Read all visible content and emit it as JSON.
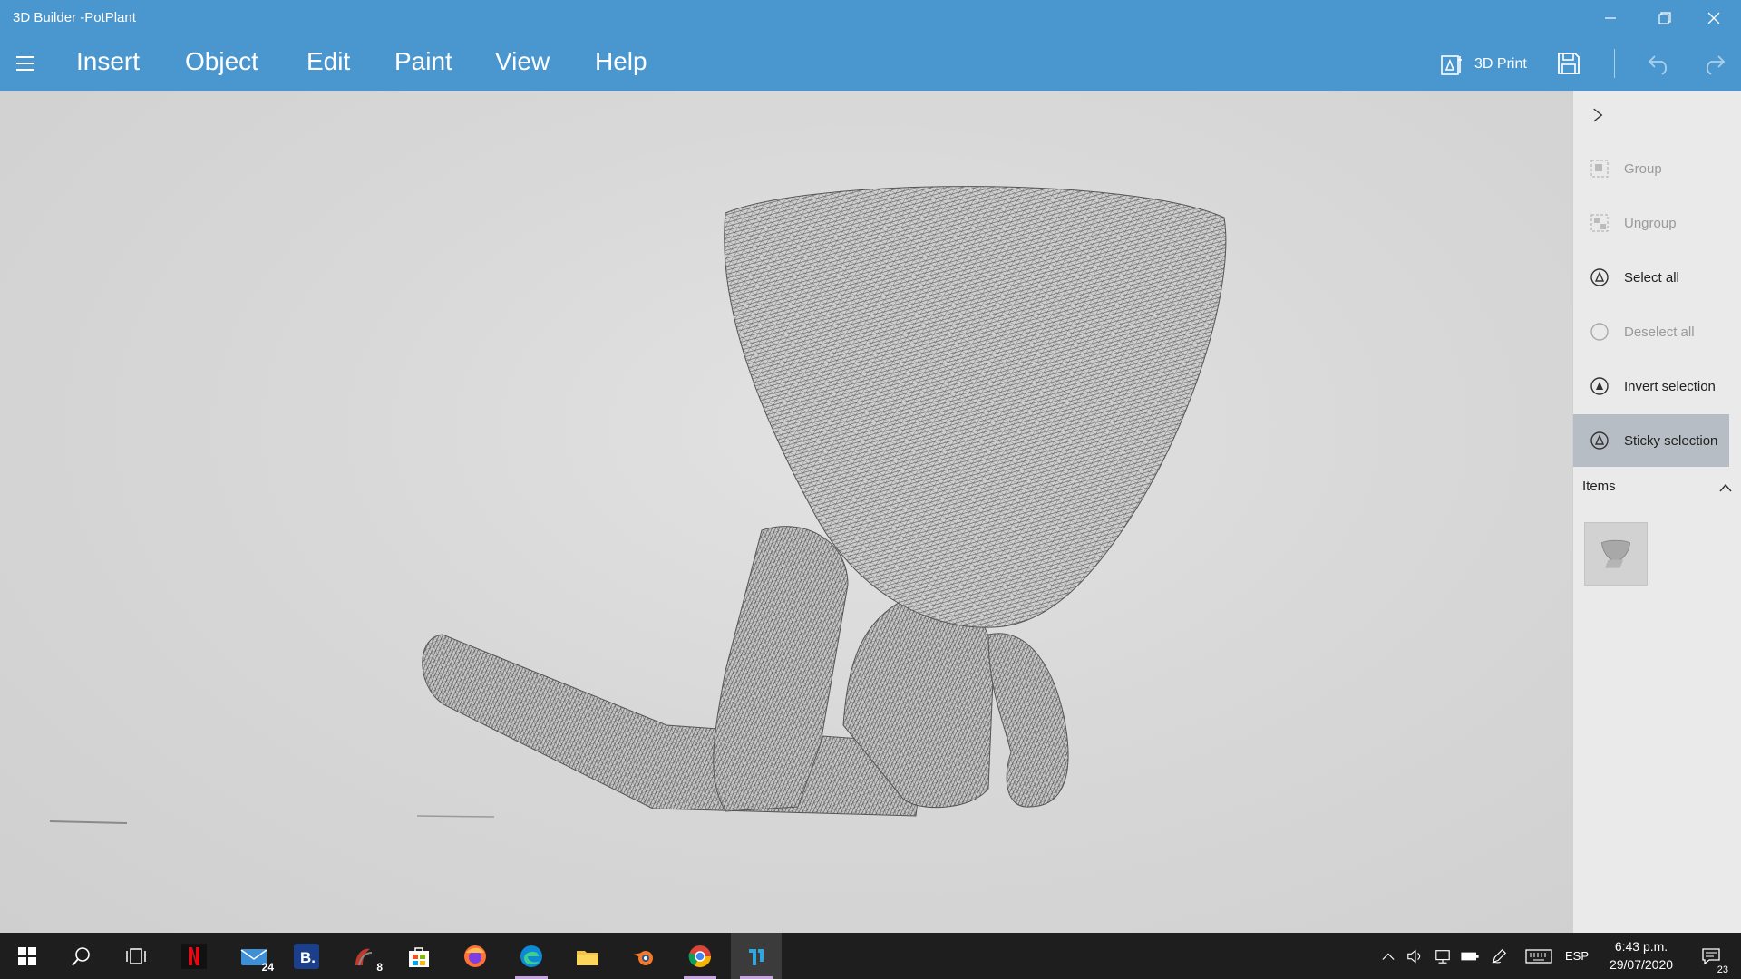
{
  "window": {
    "title": "3D Builder -PotPlant"
  },
  "menu": {
    "items": [
      {
        "label": "Insert"
      },
      {
        "label": "Object"
      },
      {
        "label": "Edit"
      },
      {
        "label": "Paint"
      },
      {
        "label": "View"
      },
      {
        "label": "Help"
      }
    ],
    "print_label": "3D Print"
  },
  "panel": {
    "actions": [
      {
        "label": "Group",
        "state": "disabled"
      },
      {
        "label": "Ungroup",
        "state": "disabled"
      },
      {
        "label": "Select all",
        "state": "enabled"
      },
      {
        "label": "Deselect all",
        "state": "disabled"
      },
      {
        "label": "Invert selection",
        "state": "enabled"
      },
      {
        "label": "Sticky selection",
        "state": "active"
      }
    ],
    "items_label": "Items"
  },
  "taskbar": {
    "apps": [
      {
        "name": "netflix"
      },
      {
        "name": "mail",
        "badge": "24"
      },
      {
        "name": "booking"
      },
      {
        "name": "app-8",
        "badge": "8"
      },
      {
        "name": "store"
      },
      {
        "name": "firefox"
      },
      {
        "name": "edge"
      },
      {
        "name": "file-explorer"
      },
      {
        "name": "blender"
      },
      {
        "name": "chrome"
      },
      {
        "name": "3d-builder"
      }
    ],
    "language": "ESP",
    "time": "6:43 p.m.",
    "date": "29/07/2020",
    "notifications": "23"
  },
  "colors": {
    "accent": "#4a97cf",
    "taskbar": "#1e1e1e",
    "panel": "#eaeaea"
  }
}
